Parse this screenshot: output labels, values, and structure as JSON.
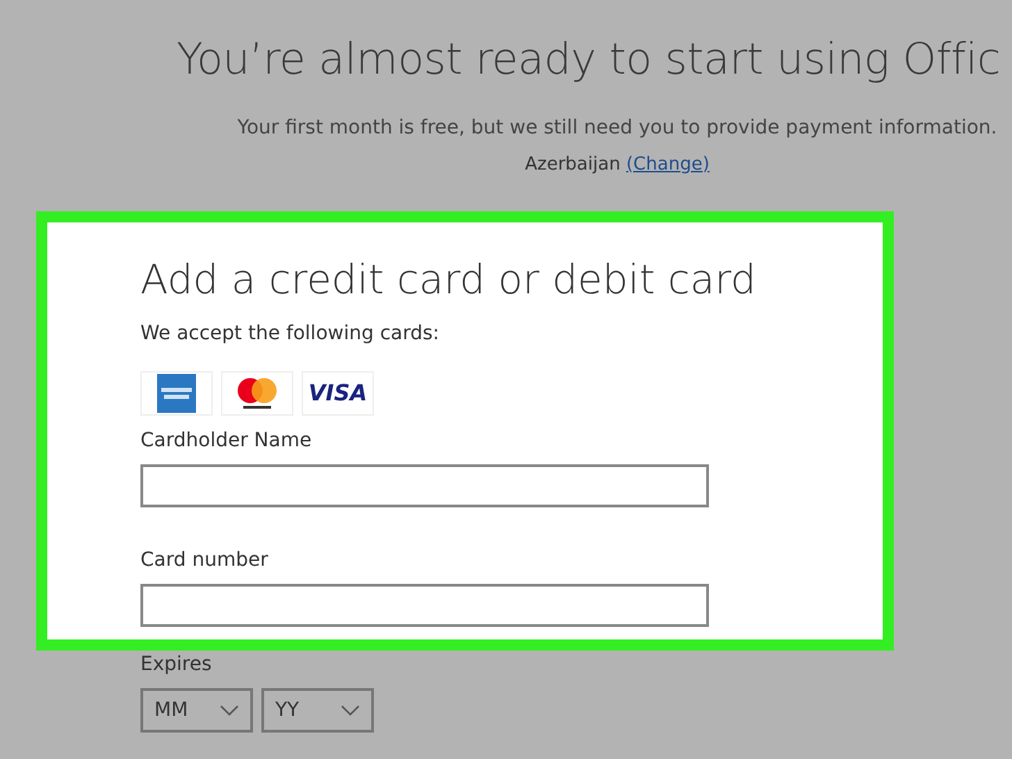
{
  "header": {
    "title": "You’re almost ready to start using Offic",
    "subtitle": "Your first month is free, but we still need you to provide payment information.",
    "country": "Azerbaijan",
    "change_link": "(Change)"
  },
  "card_form": {
    "heading": "Add a credit card or debit card",
    "accepted_label": "We accept the following cards:",
    "cards": [
      {
        "kind": "amex"
      },
      {
        "kind": "mastercard"
      },
      {
        "kind": "visa",
        "label": "VISA"
      }
    ],
    "fields": [
      {
        "label": "Cardholder Name"
      },
      {
        "label": "Card number"
      }
    ]
  },
  "expires": {
    "label": "Expires",
    "selects": [
      {
        "placeholder": "MM"
      },
      {
        "placeholder": "YY"
      }
    ]
  }
}
